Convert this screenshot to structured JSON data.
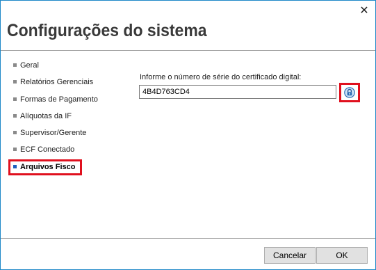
{
  "window": {
    "title": "Configurações do sistema",
    "close_glyph": "✕"
  },
  "nav": {
    "items": [
      {
        "label": "Geral",
        "active": false
      },
      {
        "label": "Relatórios Gerenciais",
        "active": false
      },
      {
        "label": "Formas de Pagamento",
        "active": false
      },
      {
        "label": "Alíquotas da IF",
        "active": false
      },
      {
        "label": "Supervisor/Gerente",
        "active": false
      },
      {
        "label": "ECF Conectado",
        "active": false
      },
      {
        "label": "Arquivos Fisco",
        "active": true
      }
    ]
  },
  "certificate": {
    "label": "Informe o número de série do certificado digital:",
    "serial_value": "4B4D763CD4",
    "lock_icon": "lock-icon"
  },
  "footer": {
    "cancel_label": "Cancelar",
    "ok_label": "OK"
  },
  "colors": {
    "highlight": "#e0101e",
    "window_border": "#1e88c8",
    "active_bullet": "#1f5fbf"
  }
}
